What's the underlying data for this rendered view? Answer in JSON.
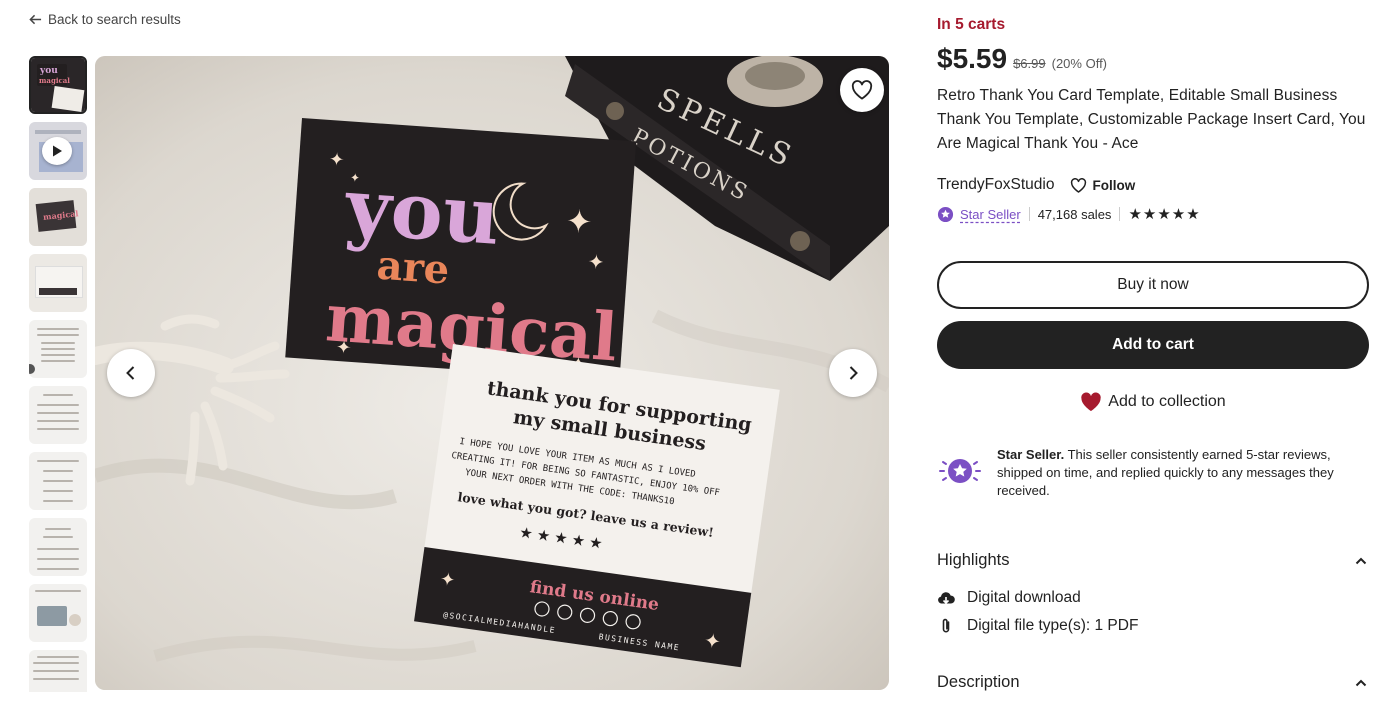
{
  "nav": {
    "back_label": "Back to search results"
  },
  "listing": {
    "in_carts": "In 5 carts",
    "price": "$5.59",
    "original_price": "$6.99",
    "discount": "(20% Off)",
    "title": "Retro Thank You Card Template, Editable Small Business Thank You Template, Customizable Package Insert Card, You Are Magical Thank You - Ace"
  },
  "shop": {
    "name": "TrendyFoxStudio",
    "follow_label": "Follow",
    "badge": "Star Seller",
    "sales": "47,168 sales",
    "rating_stars": "★★★★★"
  },
  "actions": {
    "buy_now": "Buy it now",
    "add_to_cart": "Add to cart",
    "add_to_collection": "Add to collection"
  },
  "star_seller_info": {
    "title": "Star Seller.",
    "body": " This seller consistently earned 5-star reviews, shipped on time, and replied quickly to any messages they received."
  },
  "highlights": {
    "heading": "Highlights",
    "items": [
      "Digital download",
      "Digital file type(s): 1 PDF"
    ]
  },
  "description": {
    "heading": "Description"
  },
  "product_image": {
    "card_front_lines": [
      "you",
      "are",
      "magical"
    ],
    "card_back_heading": [
      "thank you for supporting",
      "my small business"
    ],
    "card_back_body": [
      "I HOPE YOU LOVE YOUR ITEM AS MUCH AS I LOVED",
      "CREATING IT! FOR BEING SO FANTASTIC, ENJOY 10% OFF",
      "YOUR NEXT ORDER WITH THE CODE: THANKS10"
    ],
    "card_back_review": "love what you got? leave us a review!",
    "card_back_stars": "★ ★ ★ ★ ★",
    "card_back_find": "find us online",
    "card_back_handle": "@SOCIALMEDIAHANDLE",
    "card_back_business": "BUSINESS NAME",
    "book_text": [
      "SPELLS",
      "POTIONS"
    ]
  },
  "colors": {
    "accent_red": "#a61a2e",
    "star_seller_purple": "#7b4fc4",
    "button_dark": "#222222"
  }
}
